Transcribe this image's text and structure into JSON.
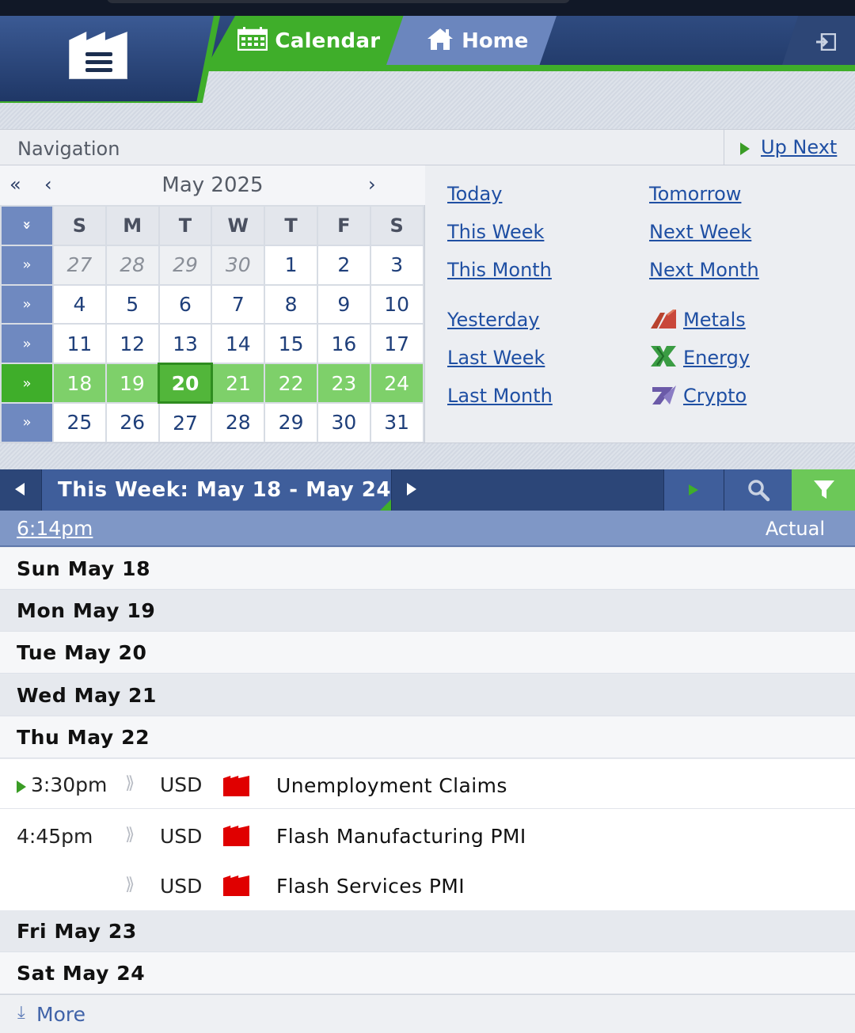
{
  "header": {
    "tabs": [
      {
        "label": "Calendar",
        "icon": "calendar-icon",
        "active": true
      },
      {
        "label": "Home",
        "icon": "home-icon",
        "active": false
      }
    ],
    "menu_icon": "factory-menu-icon",
    "exit_icon": "logout-icon",
    "colors": {
      "brand_blue": "#2f4b80",
      "accent_green": "#3fae2a"
    }
  },
  "navigation": {
    "title": "Navigation",
    "up_next": "Up Next"
  },
  "calendar": {
    "prev_year": "«",
    "prev_month": "‹",
    "month": "May 2025",
    "next_month": "›",
    "collapse_icon": "»",
    "weekday_headers": [
      "S",
      "M",
      "T",
      "W",
      "T",
      "F",
      "S"
    ],
    "week_icon": "»",
    "weeks": [
      [
        "27",
        "28",
        "29",
        "30",
        "1",
        "2",
        "3"
      ],
      [
        "4",
        "5",
        "6",
        "7",
        "8",
        "9",
        "10"
      ],
      [
        "11",
        "12",
        "13",
        "14",
        "15",
        "16",
        "17"
      ],
      [
        "18",
        "19",
        "20",
        "21",
        "22",
        "23",
        "24"
      ],
      [
        "25",
        "26",
        "27",
        "28",
        "29",
        "30",
        "31"
      ]
    ],
    "selected_week_index": 3,
    "today": "20"
  },
  "quick_links": {
    "today": "Today",
    "tomorrow": "Tomorrow",
    "this_week": "This Week",
    "next_week": "Next Week",
    "this_month": "This Month",
    "next_month": "Next Month",
    "yesterday": "Yesterday",
    "last_week": "Last Week",
    "last_month": "Last Month",
    "metals": "Metals",
    "energy": "Energy",
    "crypto": "Crypto"
  },
  "week_bar": {
    "label": "This Week: May 18 - May 24"
  },
  "time_row": {
    "time": "6:14pm",
    "actual": "Actual"
  },
  "days": {
    "sun": "Sun May 18",
    "mon": "Mon May 19",
    "tue": "Tue May 20",
    "wed": "Wed May 21",
    "thu": "Thu May 22",
    "fri": "Fri May 23",
    "sat": "Sat May 24"
  },
  "events": [
    {
      "time": "3:30pm",
      "currency": "USD",
      "impact": "high",
      "name": "Unemployment Claims",
      "up_next": true
    },
    {
      "time": "4:45pm",
      "currency": "USD",
      "impact": "high",
      "name": "Flash Manufacturing PMI"
    },
    {
      "time": "",
      "currency": "USD",
      "impact": "high",
      "name": "Flash Services PMI"
    }
  ],
  "more": {
    "label": "More"
  }
}
